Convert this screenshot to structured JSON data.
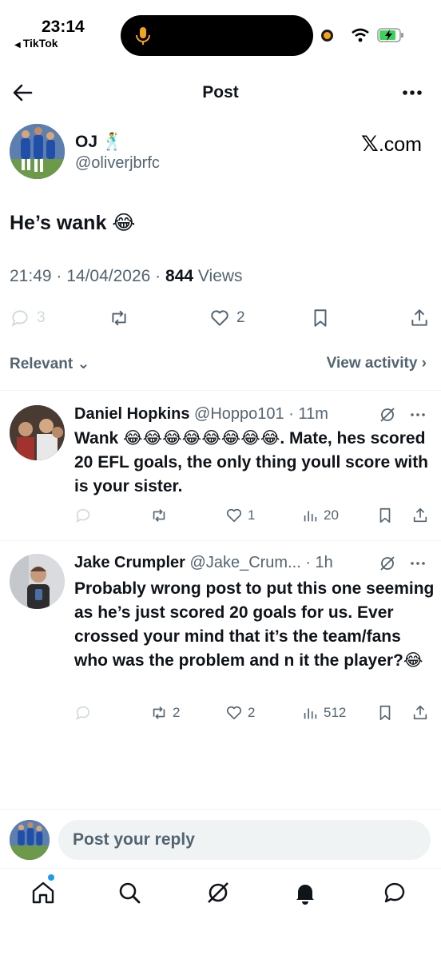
{
  "status_bar": {
    "time": "23:14",
    "back_app": "TikTok",
    "colors": {
      "recording_dot": "#f4a417",
      "battery": "#3fd15a"
    }
  },
  "nav": {
    "title": "Post"
  },
  "post": {
    "author_name": "OJ 🕺",
    "author_handle": "@oliverjbrfc",
    "source_badge_mark": "𝕏",
    "source_badge_text": ".com",
    "text": "He’s wank 😂",
    "time": "21:49",
    "date": "14/04/2026",
    "views_count": "844",
    "views_label": "Views",
    "replies_count": "3",
    "retweets_count": "",
    "likes_count": "2"
  },
  "sort": {
    "label": "Relevant",
    "view_activity": "View activity"
  },
  "replies": [
    {
      "name": "Daniel Hopkins",
      "handle": "@Hoppo101",
      "age": "11m",
      "text": "Wank 😂😂😂😂😂😂😂😂. Mate, hes scored 20 EFL goals, the only thing youll score with is your sister.",
      "reply_count": "",
      "retweet_count": "",
      "like_count": "1",
      "view_count": "20"
    },
    {
      "name": "Jake Crumpler",
      "handle": "@Jake_Crum...",
      "age": "1h",
      "text": "Probably wrong post to put this one seeming as he’s just scored 20 goals for us. Ever crossed your mind that it’s the team/fans who was the problem and n it the player?😂",
      "reply_count": "",
      "retweet_count": "2",
      "like_count": "2",
      "view_count": "512"
    }
  ],
  "composer": {
    "placeholder": "Post your reply"
  },
  "icons": {
    "tabs": [
      "home-icon",
      "search-icon",
      "grok-icon",
      "notifications-icon",
      "messages-icon"
    ],
    "accent": "#1d9bf0"
  }
}
